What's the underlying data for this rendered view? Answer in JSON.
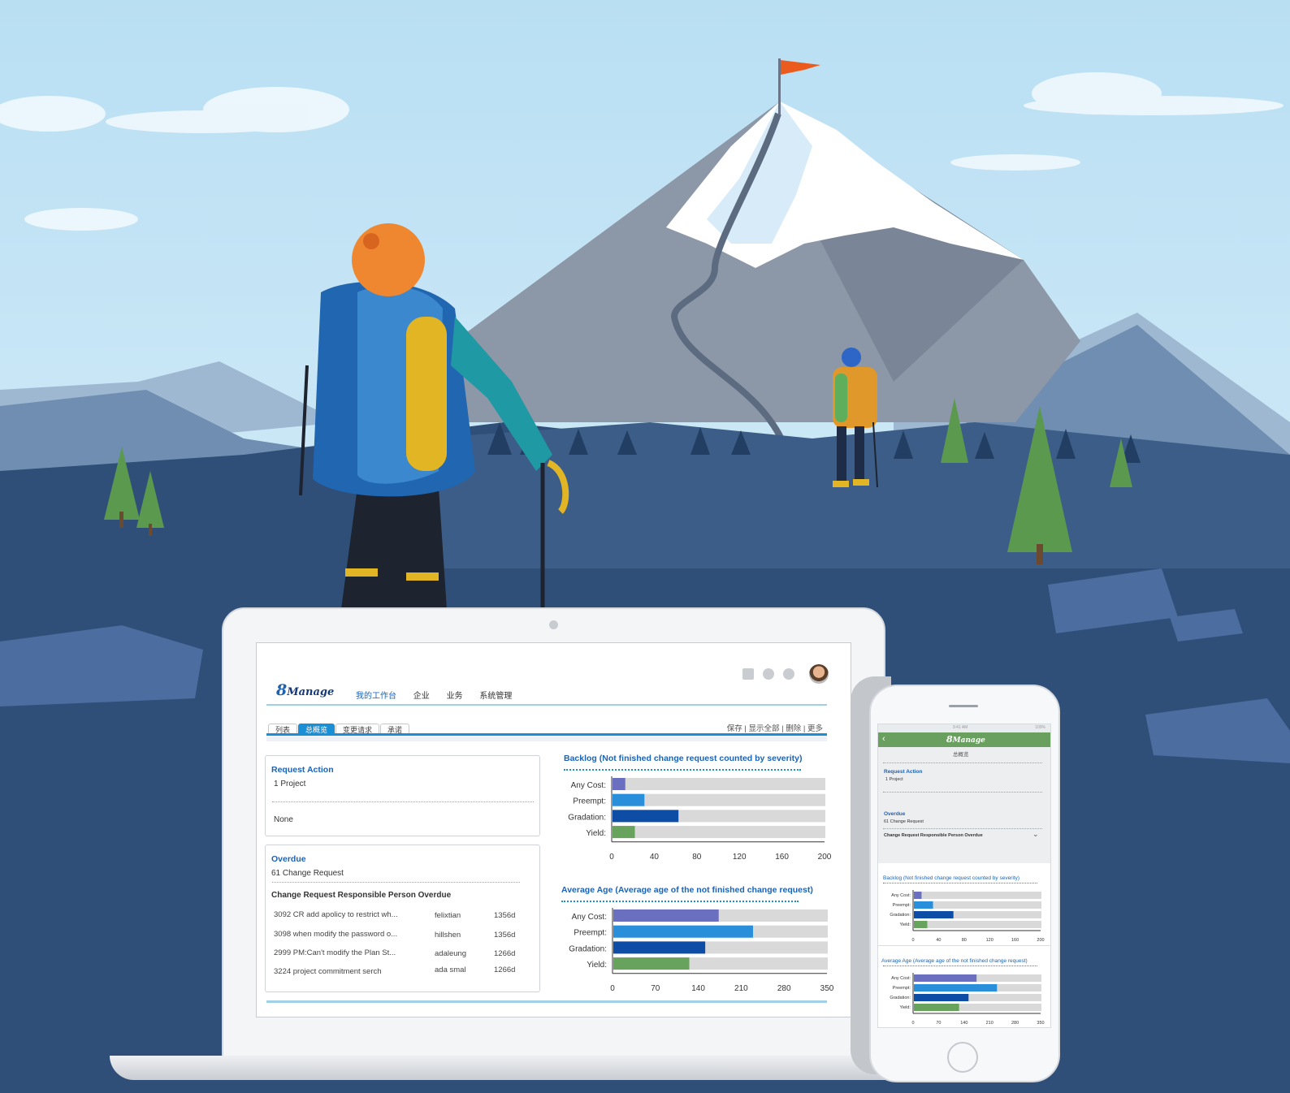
{
  "app": {
    "logo_number": "8",
    "logo_word": "Manage",
    "nav": [
      "我的工作台",
      "企业",
      "业务",
      "系统管理"
    ],
    "tabs": [
      "列表",
      "总概览",
      "变更请求",
      "承诺"
    ],
    "active_tab": "总概览",
    "actions": "保存 | 显示全部 | 删除 | 更多",
    "header_icons": [
      "grid-icon",
      "help-icon",
      "settings-icon",
      "user-avatar"
    ]
  },
  "request_action": {
    "title": "Request Action",
    "count": "1 Project",
    "empty_text": "None"
  },
  "overdue": {
    "title": "Overdue",
    "count": "61 Change Request",
    "subtitle": "Change Request Responsible Person Overdue",
    "rows": [
      {
        "item": "3092 CR add apolicy to restrict wh...",
        "person": "felixtian",
        "age": "1356d"
      },
      {
        "item": "3098 when modify the password o...",
        "person": "hillshen",
        "age": "1356d"
      },
      {
        "item": "2999 PM:Can't modify the Plan St...",
        "person": "adaleung",
        "age": "1266d"
      },
      {
        "item": "3224 project commitment serch",
        "person": "ada smal",
        "age": "1266d"
      }
    ]
  },
  "colors": {
    "accent": "#1b8fd6",
    "title_blue": "#1b63b5",
    "bar_any_cost": "#6b6fbf",
    "bar_preempt": "#2a8fdb",
    "bar_gradation": "#0d4da6",
    "bar_yield": "#67a35c",
    "track": "#d9d9d9"
  },
  "chart_data": [
    {
      "type": "bar",
      "orientation": "horizontal",
      "title": "Backlog  (Not finished change request counted by severity)",
      "categories": [
        "Any Cost:",
        "Preempt:",
        "Gradation:",
        "Yield:"
      ],
      "values": [
        12,
        30,
        62,
        21
      ],
      "xlim": [
        0,
        200
      ],
      "ticks": [
        "0",
        "40",
        "80",
        "120",
        "160",
        "200"
      ],
      "grid": false
    },
    {
      "type": "bar",
      "orientation": "horizontal",
      "title": "Average Age  (Average age of the not finished change request)",
      "categories": [
        "Any Cost:",
        "Preempt:",
        "Gradation:",
        "Yield:"
      ],
      "values": [
        172,
        228,
        150,
        124
      ],
      "xlim": [
        0,
        350
      ],
      "ticks": [
        "0",
        "70",
        "140",
        "210",
        "280",
        "350"
      ],
      "grid": false
    }
  ],
  "mobile": {
    "logo_number": "8",
    "logo_word": "Manage",
    "status_time": "9:41 AM",
    "status_battery": "100%",
    "page_title": "总概览",
    "request_action_title": "Request Action",
    "request_action_count": "1 Project",
    "overdue_title": "Overdue",
    "overdue_count": "61 Change Request",
    "overdue_subtitle": "Change Request Responsible Person Overdue"
  }
}
